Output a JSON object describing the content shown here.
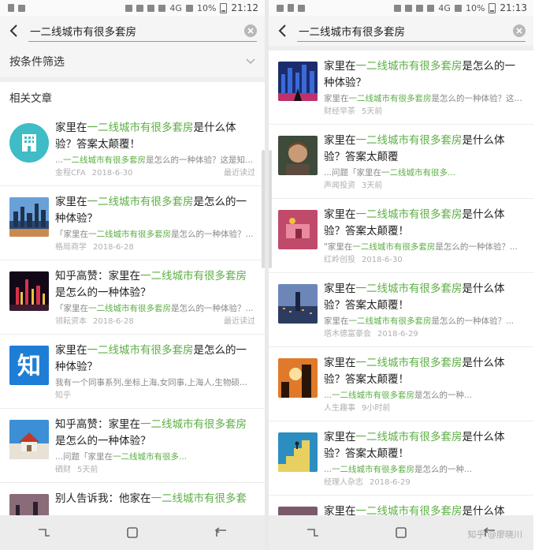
{
  "left": {
    "status": {
      "network": "4G",
      "battery": "10%",
      "time": "21:12"
    },
    "search": {
      "value": "一二线城市有很多套房"
    },
    "filter_label": "按条件筛选",
    "section_title": "相关文章",
    "articles": [
      {
        "title": [
          {
            "t": "家里在"
          },
          {
            "t": "一二线城市有很多套房",
            "h": true
          },
          {
            "t": "是什么体验？答案太颠覆！"
          }
        ],
        "snippet": [
          {
            "t": "..."
          },
          {
            "t": "一二线城市有很多套房",
            "h": true
          },
          {
            "t": "是怎么的一种体验？这是知..."
          }
        ],
        "source": "金程CFA",
        "date": "2018-6-30",
        "tag": "最近读过"
      },
      {
        "title": [
          {
            "t": "家里在"
          },
          {
            "t": "一二线城市有很多套房",
            "h": true
          },
          {
            "t": "是怎么的一种体验？"
          }
        ],
        "snippet": [
          {
            "t": "「家里在"
          },
          {
            "t": "一二线城市有很多套房",
            "h": true
          },
          {
            "t": "是怎么的一种体验？..."
          }
        ],
        "source": "格局商学",
        "date": "2018-6-28",
        "tag": ""
      },
      {
        "title": [
          {
            "t": "知乎高赞：家里在"
          },
          {
            "t": "一二线城市有很多套房",
            "h": true
          },
          {
            "t": "是怎么的一种体验？"
          }
        ],
        "snippet": [
          {
            "t": "「家里在"
          },
          {
            "t": "一二线城市有很多套房",
            "h": true
          },
          {
            "t": "是怎么的一种体验？..."
          }
        ],
        "source": "领耘资本",
        "date": "2018-6-28",
        "tag": "最近读过"
      },
      {
        "title": [
          {
            "t": "家里在"
          },
          {
            "t": "一二线城市有很多套房",
            "h": true
          },
          {
            "t": "是怎么的一种体验？"
          }
        ],
        "snippet": [
          {
            "t": "我有一个同事系列,坐标上海,女同事,上海人,生物硕..."
          }
        ],
        "source": "知乎",
        "date": "",
        "tag": ""
      },
      {
        "title": [
          {
            "t": "知乎高赞：家里在"
          },
          {
            "t": "一二线城市有很多套房",
            "h": true
          },
          {
            "t": "是怎么的一种体验？"
          }
        ],
        "snippet": [
          {
            "t": "...问题「家里在"
          },
          {
            "t": "一二线城市有很多...",
            "h": true
          }
        ],
        "source": "硒财",
        "date": "5天前",
        "tag": ""
      },
      {
        "title": [
          {
            "t": "别人告诉我：他家在"
          },
          {
            "t": "一二线城市有很多套",
            "h": true
          }
        ],
        "snippet": [],
        "source": "",
        "date": "",
        "tag": ""
      }
    ]
  },
  "right": {
    "status": {
      "network": "4G",
      "battery": "10%",
      "time": "21:13"
    },
    "search": {
      "value": "一二线城市有很多套房"
    },
    "articles": [
      {
        "title": [
          {
            "t": "家里在"
          },
          {
            "t": "一二线城市有很多套房",
            "h": true
          },
          {
            "t": "是怎么的一种体验？"
          }
        ],
        "snippet": [
          {
            "t": "家里在"
          },
          {
            "t": "一二线城市有很多套房",
            "h": true
          },
          {
            "t": "是怎么的一种体验？这是知..."
          }
        ],
        "source": "财经早茶",
        "date": "5天前",
        "tag": ""
      },
      {
        "title": [
          {
            "t": "家里在"
          },
          {
            "t": "一二线城市有很多套房",
            "h": true
          },
          {
            "t": "是什么体验？答案太颠覆"
          }
        ],
        "snippet": [
          {
            "t": "...问题「家里在"
          },
          {
            "t": "一二线城市有很多...",
            "h": true
          }
        ],
        "source": "声闻投资",
        "date": "3天前",
        "tag": ""
      },
      {
        "title": [
          {
            "t": "家里在"
          },
          {
            "t": "一二线城市有很多套房",
            "h": true
          },
          {
            "t": "是什么体验？答案太颠覆！"
          }
        ],
        "snippet": [
          {
            "t": "\"家里在"
          },
          {
            "t": "一二线城市有很多套房",
            "h": true
          },
          {
            "t": "是怎么的一种体验？..."
          }
        ],
        "source": "红岭创投",
        "date": "2018-6-30",
        "tag": ""
      },
      {
        "title": [
          {
            "t": "家里在"
          },
          {
            "t": "一二线城市有很多套房",
            "h": true
          },
          {
            "t": "是什么体验？答案太颠覆！"
          }
        ],
        "snippet": [
          {
            "t": "家里在"
          },
          {
            "t": "一二线城市有很多套房",
            "h": true
          },
          {
            "t": "是怎么的一种体验？..."
          }
        ],
        "source": "塔木德富豪会",
        "date": "2018-6-29",
        "tag": ""
      },
      {
        "title": [
          {
            "t": "家里在"
          },
          {
            "t": "一二线城市有很多套房",
            "h": true
          },
          {
            "t": "是什么体验？答案太颠覆！"
          }
        ],
        "snippet": [
          {
            "t": "..."
          },
          {
            "t": "一二线城市有很多套房",
            "h": true
          },
          {
            "t": "是怎么的一种..."
          }
        ],
        "source": "人生趣事",
        "date": "9小时前",
        "tag": ""
      },
      {
        "title": [
          {
            "t": "家里在"
          },
          {
            "t": "一二线城市有很多套房",
            "h": true
          },
          {
            "t": "是什么体验？答案太颠覆！"
          }
        ],
        "snippet": [
          {
            "t": "..."
          },
          {
            "t": "一二线城市有很多套房",
            "h": true
          },
          {
            "t": "是怎么的一种..."
          }
        ],
        "source": "经理人杂志",
        "date": "2018-6-29",
        "tag": ""
      },
      {
        "title": [
          {
            "t": "家里在"
          },
          {
            "t": "一二线城市有很多套房",
            "h": true
          },
          {
            "t": "是什么体验？"
          }
        ],
        "snippet": [],
        "source": "",
        "date": "",
        "tag": ""
      }
    ],
    "watermark": "知乎 @廖晓川"
  },
  "colors": {
    "highlight": "#5cae44",
    "accent_underline": "#6bbb52"
  },
  "thumbnails_left": [
    "building-icon",
    "city-skyline",
    "night-city",
    "zhihu-logo",
    "house-model",
    "dusk-city"
  ],
  "thumbnails_right": [
    "city-night",
    "man-portrait",
    "pink-illustration",
    "city-aerial",
    "sunset-building",
    "stairs-figure",
    "city-dusk"
  ]
}
